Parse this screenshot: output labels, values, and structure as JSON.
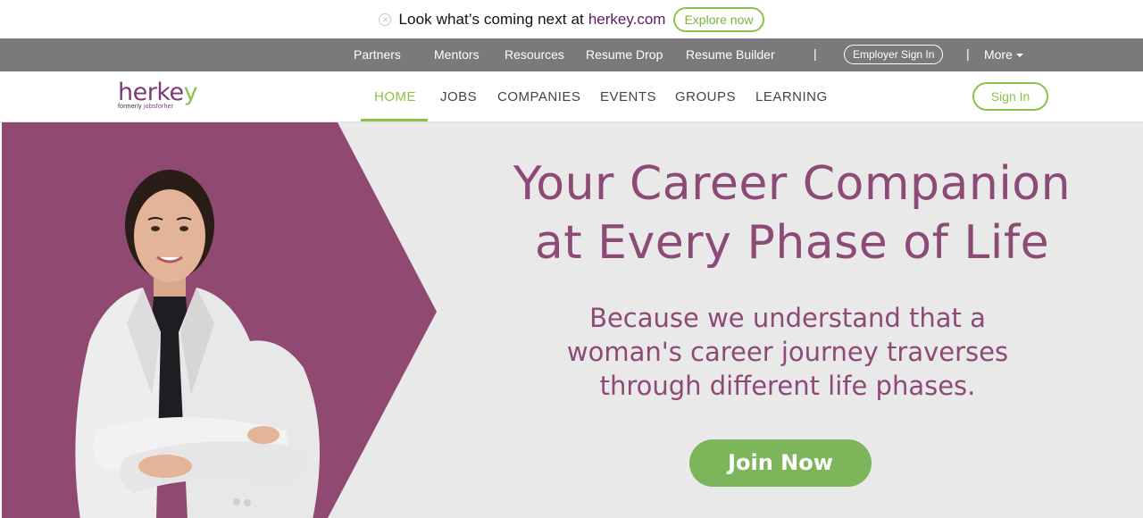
{
  "announcement": {
    "message": "Look what’s coming next at",
    "brand_link": "herkey.com",
    "explore_label": "Explore now"
  },
  "topnav": {
    "items": [
      "Partners",
      "Mentors",
      "Resources",
      "Resume Drop",
      "Resume Builder"
    ],
    "employer_label": "Employer Sign In",
    "more_label": "More",
    "separator": "|"
  },
  "header": {
    "logo": {
      "wordmark_main": "herke",
      "wordmark_y": "y",
      "formerly_prefix": "formerly",
      "formerly_brand": "jobsforher"
    },
    "nav": [
      "HOME",
      "JOBS",
      "COMPANIES",
      "EVENTS",
      "GROUPS",
      "LEARNING"
    ],
    "active_nav": "HOME",
    "signin_label": "Sign In"
  },
  "hero": {
    "headline_line1": "Your Career Companion",
    "headline_line2": "at Every Phase of Life",
    "sub_line1": "Because we understand that a",
    "sub_line2": "woman's career journey traverses",
    "sub_line3": "through different life phases.",
    "cta_label": "Join Now"
  },
  "colors": {
    "plum": "#904a71",
    "accent_green": "#8bc34a",
    "nav_gray": "#7a7a7a",
    "hero_bg": "#e9e9e9",
    "cta_green": "#7cb55a"
  }
}
